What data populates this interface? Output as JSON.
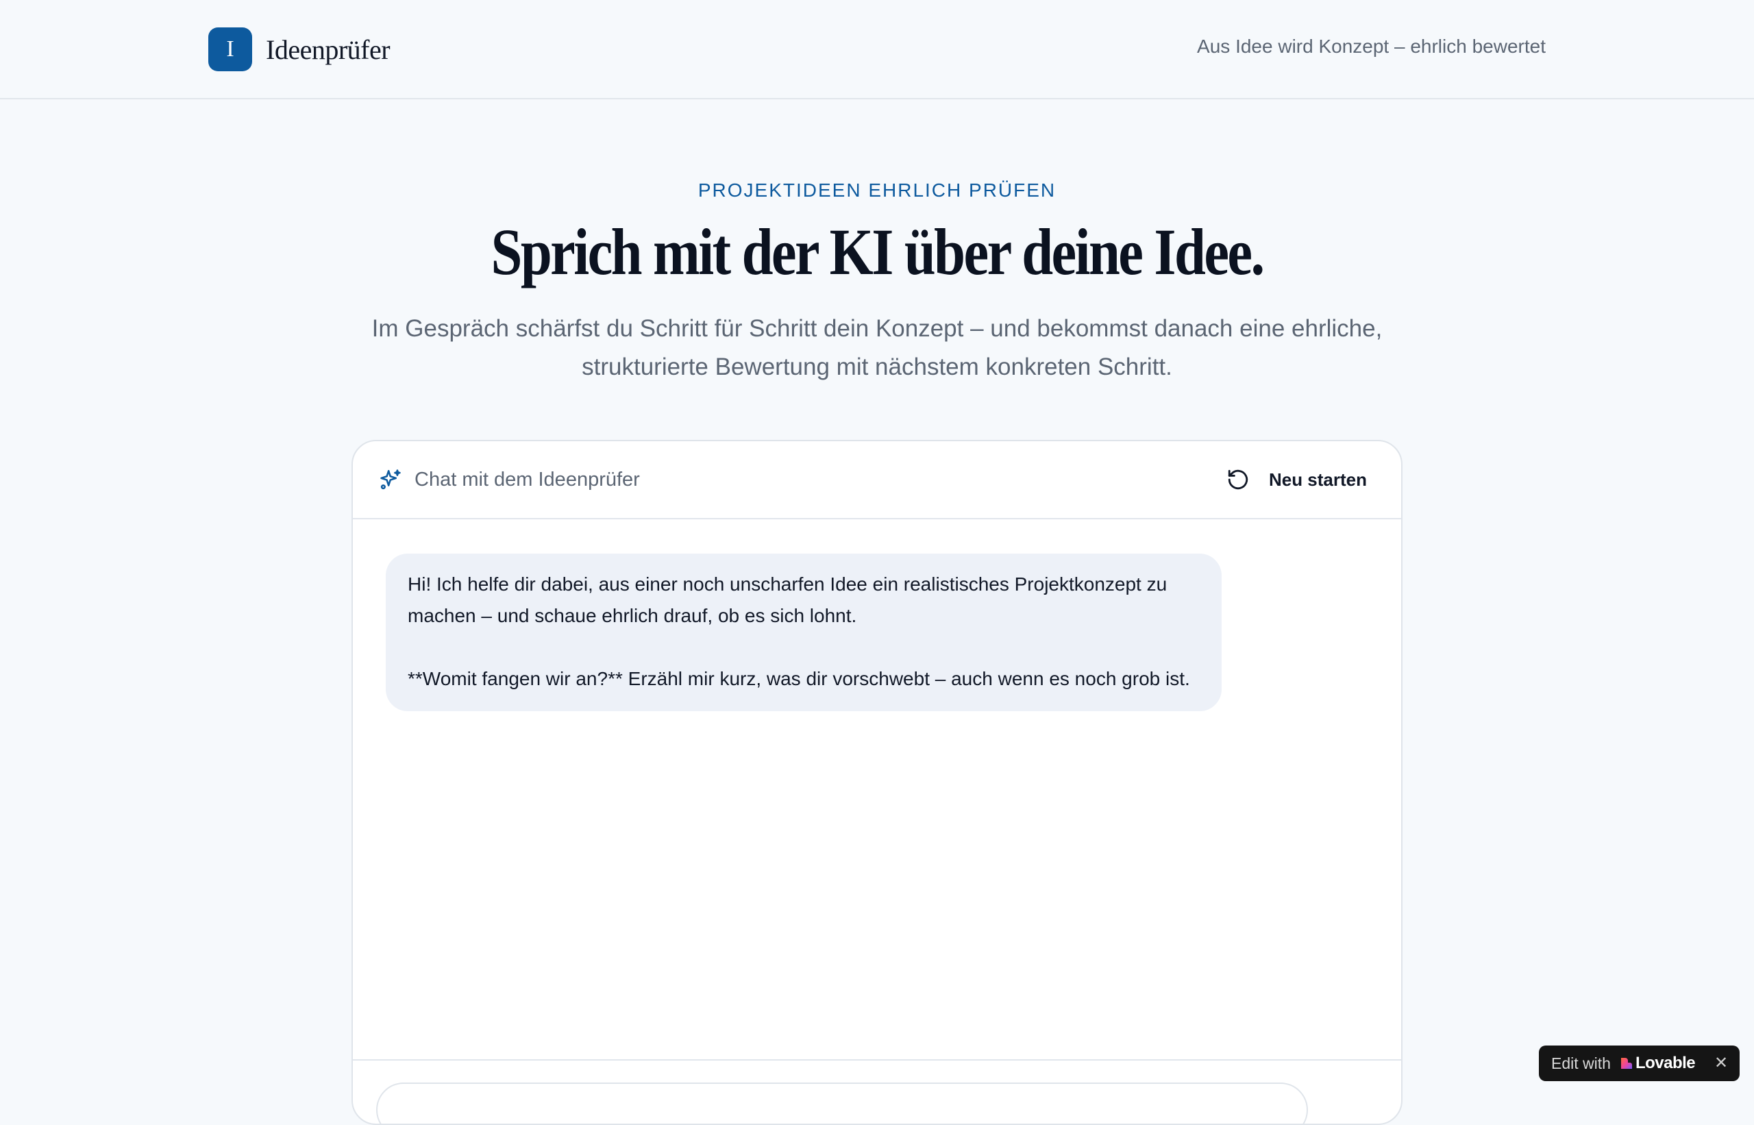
{
  "header": {
    "logo_letter": "I",
    "brand_name": "Ideenprüfer",
    "tagline": "Aus Idee wird Konzept – ehrlich bewertet"
  },
  "hero": {
    "eyebrow": "PROJEKTIDEEN EHRLICH PRÜFEN",
    "headline": "Sprich mit der KI über deine Idee.",
    "subline": "Im Gespräch schärfst du Schritt für Schritt dein Konzept – und bekommst danach eine ehrliche, strukturierte Bewertung mit nächstem konkreten Schritt."
  },
  "chat": {
    "title": "Chat mit dem Ideenprüfer",
    "restart_label": "Neu starten",
    "messages": [
      {
        "role": "assistant",
        "paragraph_1": "Hi! Ich helfe dir dabei, aus einer noch unscharfen Idee ein realistisches Projektkonzept zu machen – und schaue ehrlich drauf, ob es sich lohnt.",
        "paragraph_2": "**Womit fangen wir an?** Erzähl mir kurz, was dir vorschwebt – auch wenn es noch grob ist."
      }
    ]
  },
  "badge": {
    "prefix": "Edit with",
    "brand": "Lovable",
    "close": "✕"
  },
  "colors": {
    "accent": "#0d5a9e",
    "background": "#f6f9fc",
    "bubble": "#edf1f8"
  }
}
